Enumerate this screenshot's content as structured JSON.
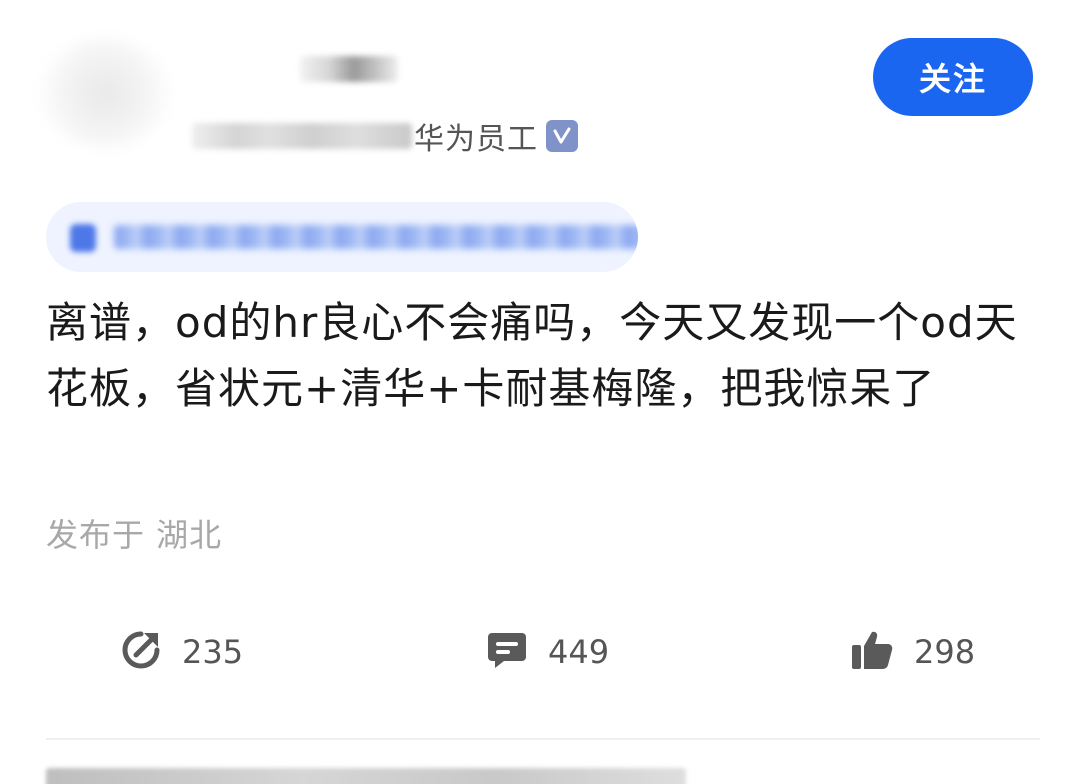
{
  "header": {
    "role_label": "华为员工",
    "follow_label": "关注",
    "verified_icon": "verified-v-icon"
  },
  "post": {
    "body_text": "离谱，od的hr良心不会痛吗，今天又发现一个od天花板，省状元+清华+卡耐基梅隆，把我惊呆了",
    "location": "发布于 湖北"
  },
  "actions": {
    "share_count": "235",
    "comment_count": "449",
    "like_count": "298"
  },
  "colors": {
    "accent": "#1a66f0",
    "verified": "#7f93c8",
    "topic_chip_bg": "#eef3ff",
    "muted_text": "#a8a8a8",
    "icon": "#555555"
  }
}
